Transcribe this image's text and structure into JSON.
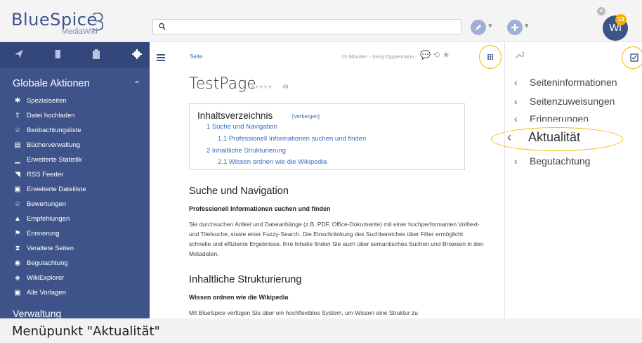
{
  "header": {
    "logo_main": "BlueSpice",
    "logo_sub": "MediaWiki",
    "logo_number": "3",
    "search_placeholder": "",
    "avatar_initials": "Wi",
    "notification_count": "13"
  },
  "sidebar": {
    "heading": "Globale Aktionen",
    "items": [
      {
        "label": "Spezialseiten",
        "icon": "special-pages-icon",
        "glyph": "✱"
      },
      {
        "label": "Datei hochladen",
        "icon": "upload-icon",
        "glyph": "⇪"
      },
      {
        "label": "Beobachtungsliste",
        "icon": "star-outline-icon",
        "glyph": "☆"
      },
      {
        "label": "Bücherverwaltung",
        "icon": "books-icon",
        "glyph": "▤"
      },
      {
        "label": "Erweiterte Statistik",
        "icon": "statistics-icon",
        "glyph": "▁"
      },
      {
        "label": "RSS Feeder",
        "icon": "rss-icon",
        "glyph": "◥"
      },
      {
        "label": "Erweiterte Dateiliste",
        "icon": "file-list-icon",
        "glyph": "▣"
      },
      {
        "label": "Bewertungen",
        "icon": "star-outline-icon",
        "glyph": "☆"
      },
      {
        "label": "Empfehlungen",
        "icon": "recommend-icon",
        "glyph": "▲"
      },
      {
        "label": "Erinnerung",
        "icon": "flag-icon",
        "glyph": "⚑"
      },
      {
        "label": "Veraltete Seiten",
        "icon": "hourglass-icon",
        "glyph": "⧗"
      },
      {
        "label": "Begutachtung",
        "icon": "eye-icon",
        "glyph": "◉"
      },
      {
        "label": "WikiExplorer",
        "icon": "explorer-icon",
        "glyph": "◈"
      },
      {
        "label": "Alle Vorlagen",
        "icon": "templates-icon",
        "glyph": "▣"
      }
    ],
    "next_heading": "Verwaltung"
  },
  "page": {
    "breadcrumb": "Seite",
    "meta": "15 Minuten - Sissy Oppermann",
    "title": "TestPage",
    "stars": "★★★★★",
    "rating_count": "(0)",
    "toc": {
      "title": "Inhaltsverzeichnis",
      "toggle": "[Verbergen]",
      "items": [
        "1   Suche und Navigation",
        "1.1   Professionell Informationen suchen und finden",
        "2   Inhaltliche Strukturierung",
        "2.1   Wissen ordnen wie die Wikipedia"
      ]
    },
    "section1": {
      "heading": "Suche und Navigation",
      "subheading": "Professionell Informationen suchen und finden",
      "paragraph": "Sie durchsuchen Artikel und Dateianhänge (z.B. PDF, Office-Dokumente) mit einer hochperformanten Volltext- und Titelsuche, sowie einer Fuzzy-Search. Die Einschränkung des Suchbereiches über Filter ermöglicht schnelle und effiziente Ergebnisse. Ihre Inhalte finden Sie auch über semantisches Suchen und Browsen in den Metadaten."
    },
    "section2": {
      "heading": "Inhaltliche Strukturierung",
      "subheading": "Wissen ordnen wie die Wikipedia",
      "paragraph": "Mit BlueSpice verfügen Sie über ein hochflexibles System, um Wissen eine Struktur zu"
    }
  },
  "right_panel": {
    "items": [
      {
        "label": "Seiteninformationen",
        "chevron": "‹"
      },
      {
        "label": "Seitenzuweisungen",
        "chevron": "‹"
      },
      {
        "label": "Erinnerungen",
        "chevron": "‹"
      },
      {
        "label": "Aktualität",
        "chevron": "‹"
      },
      {
        "label": "Begutachtung",
        "chevron": "‹"
      }
    ]
  },
  "caption": "Menüpunkt \"Aktualität\"",
  "colors": {
    "brand_blue": "#3e5389",
    "highlight": "#f5b800",
    "link": "#3a6bbd"
  }
}
